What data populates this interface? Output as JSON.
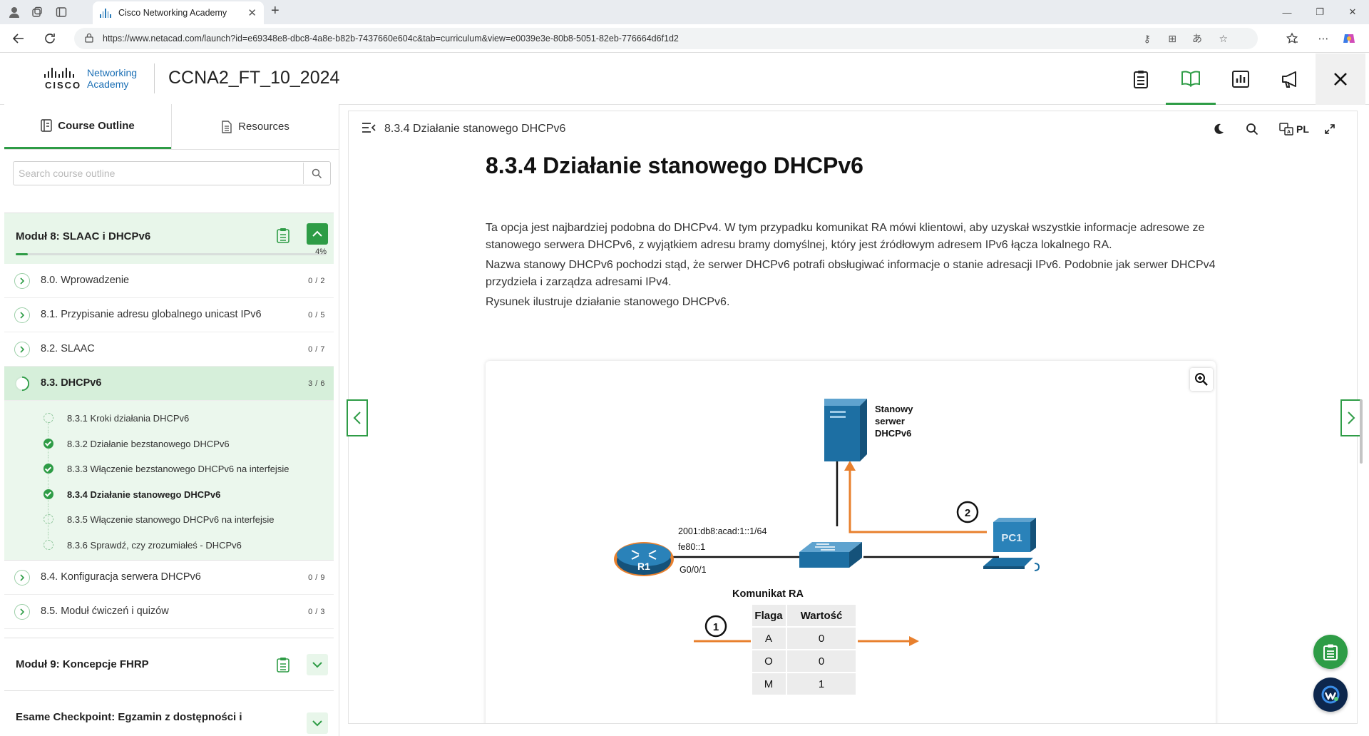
{
  "browser": {
    "tab_title": "Cisco Networking Academy",
    "url": "https://www.netacad.com/launch?id=e69348e8-dbc8-4a8e-b82b-7437660e604c&tab=curriculum&view=e0039e3e-80b8-5051-82eb-776664d6f1d2"
  },
  "header": {
    "logo_brand": "CISCO",
    "logo_product_line1": "Networking",
    "logo_product_line2": "Academy",
    "course_title": "CCNA2_FT_10_2024"
  },
  "sidebar": {
    "tabs": [
      {
        "label": "Course Outline"
      },
      {
        "label": "Resources"
      }
    ],
    "search_placeholder": "Search course outline",
    "current_module": {
      "title": "Moduł 8: SLAAC i DHCPv6",
      "progress_label": "4%",
      "progress_value": 0.04,
      "topics": [
        {
          "label": "8.0. Wprowadzenie",
          "count": "0 / 2"
        },
        {
          "label": "8.1. Przypisanie adresu globalnego unicast IPv6",
          "count": "0 / 5"
        },
        {
          "label": "8.2. SLAAC",
          "count": "0 / 7"
        },
        {
          "label": "8.3. DHCPv6",
          "count": "3 / 6"
        }
      ],
      "subtopics": [
        {
          "label": "8.3.1 Kroki działania DHCPv6",
          "status": "partial"
        },
        {
          "label": "8.3.2 Działanie bezstanowego DHCPv6",
          "status": "done"
        },
        {
          "label": "8.3.3 Włączenie bezstanowego DHCPv6 na interfejsie",
          "status": "done"
        },
        {
          "label": "8.3.4 Działanie stanowego DHCPv6",
          "status": "done"
        },
        {
          "label": "8.3.5 Włączenie stanowego DHCPv6 na interfejsie",
          "status": "pending"
        },
        {
          "label": "8.3.6 Sprawdź, czy zrozumiałeś - DHCPv6",
          "status": "pending"
        }
      ],
      "topics_after": [
        {
          "label": "8.4. Konfiguracja serwera DHCPv6",
          "count": "0 / 9"
        },
        {
          "label": "8.5. Moduł ćwiczeń i quizów",
          "count": "0 / 3"
        }
      ]
    },
    "next_modules": [
      {
        "title": "Moduł 9: Koncepcje FHRP"
      },
      {
        "title": "Esame Checkpoint: Egzamin z dostępności i"
      }
    ]
  },
  "content": {
    "breadcrumb": "8.3.4 Działanie stanowego DHCPv6",
    "language": "PL",
    "title": "8.3.4 Działanie stanowego DHCPv6",
    "paragraphs": [
      "Ta opcja jest najbardziej podobna do DHCPv4. W tym przypadku komunikat RA mówi klientowi, aby uzyskał wszystkie informacje adresowe ze stanowego serwera DHCPv6, z wyjątkiem adresu bramy domyślnej, który jest źródłowym adresem IPv6 łącza lokalnego RA.",
      "Nazwa stanowy DHCPv6 pochodzi stąd, że serwer DHCPv6 potrafi obsługiwać informacje o stanie adresacji IPv6. Podobnie jak serwer DHCPv4 przydziela i zarządza adresami IPv4.",
      "Rysunek ilustruje działanie stanowego DHCPv6."
    ],
    "diagram": {
      "server_label": [
        "Stanowy",
        "serwer",
        "DHCPv6"
      ],
      "router_label": "R1",
      "router_address": "2001:db8:acad:1::1/64",
      "router_link_local": "fe80::1",
      "router_interface": "G0/0/1",
      "pc_label": "PC1",
      "step_1": "1",
      "step_2": "2",
      "ra_title": "Komunikat RA",
      "ra_headers": [
        "Flaga",
        "Wartość"
      ],
      "ra_rows": [
        [
          "A",
          "0"
        ],
        [
          "O",
          "0"
        ],
        [
          "M",
          "1"
        ]
      ],
      "colors": {
        "arrow": "#e8802e",
        "device_blue": "#1d6fa3",
        "router_ring": "#e8802e"
      }
    }
  },
  "colors": {
    "accent": "#2e9c46",
    "accent_light": "#e8f6ea"
  }
}
